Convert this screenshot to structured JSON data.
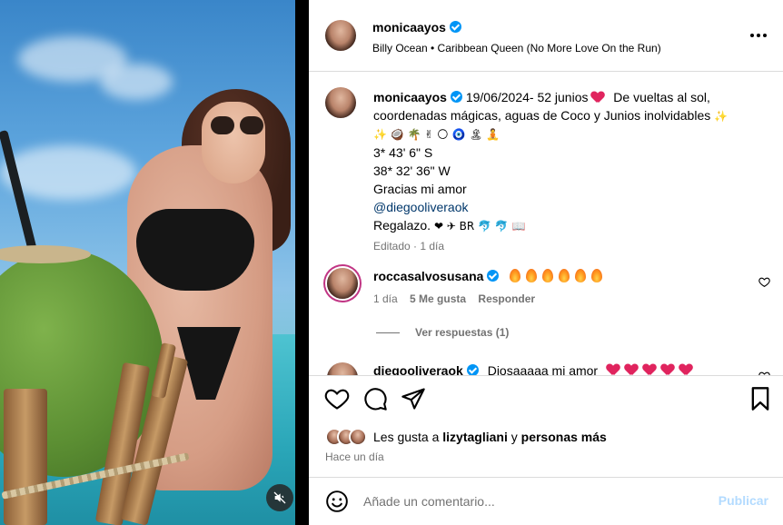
{
  "post": {
    "author": "monicaayos",
    "audio": "Billy Ocean • Caribbean Queen (No More Love On the Run)"
  },
  "caption": {
    "author": "monicaayos",
    "line1": "19/06/2024- 52 junios",
    "line1_rest": "De vueltas al sol,",
    "line2": "coordenadas mágicas, aguas de Coco y Junios inolvidables",
    "line3_emojis": "✨ 🥥 🌴 ✌ 🌕 🧿 🏝 🧘",
    "coord_lat": "3* 43' 6\" S",
    "coord_lon": "38* 32' 36\" W",
    "thanks": "Gracias mi amor",
    "mention": "@diegooliveraok",
    "gift": "Regalazo.",
    "gift_emojis": "❤ ✈ BR 🐬 🐬 📖",
    "meta": "Editado · 1 día"
  },
  "comments": [
    {
      "author": "roccasalvosusana",
      "flames": 6,
      "time": "1 día",
      "likes": "5 Me gusta",
      "reply": "Responder",
      "view_replies": "Ver respuestas (1)"
    },
    {
      "author": "diegooliveraok",
      "text": "Diosaaaaa mi amor",
      "hearts": 5
    }
  ],
  "likes": {
    "prefix": "Les gusta a",
    "user": "lizytagliani",
    "connector": "y",
    "others": "personas más"
  },
  "time_ago": "Hace un día",
  "comment_input": {
    "placeholder": "Añade un comentario...",
    "publish": "Publicar"
  },
  "colors": {
    "accent": "#0095f6",
    "publish_disabled": "#b3dbff",
    "meta_gray": "#737373",
    "mention_blue": "#00376b"
  }
}
